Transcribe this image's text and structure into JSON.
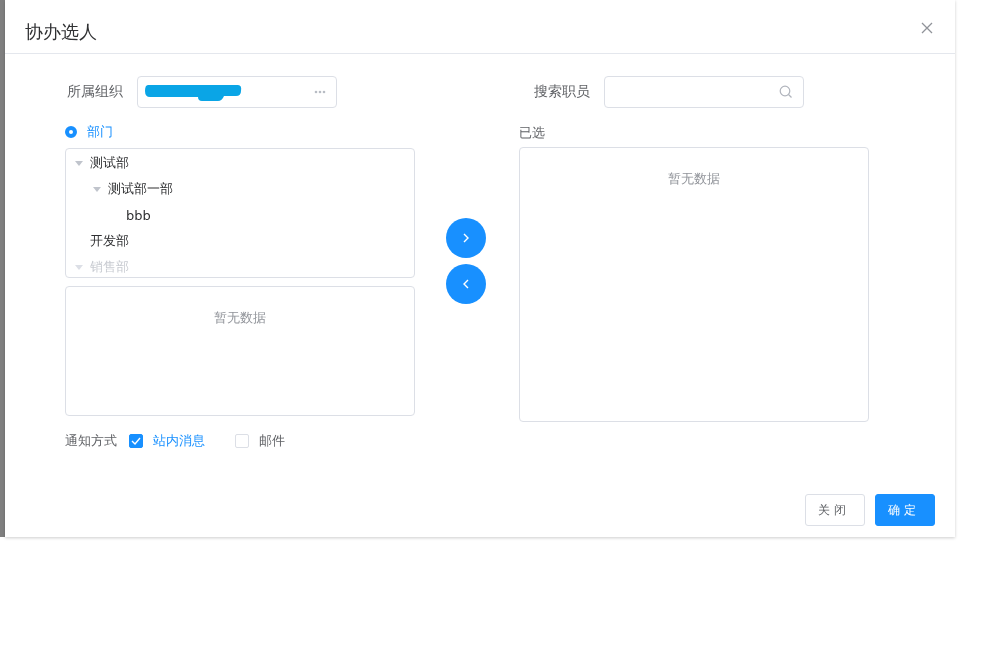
{
  "dialog": {
    "title": "协办选人"
  },
  "organization": {
    "label": "所属组织",
    "redacted": true
  },
  "search": {
    "label": "搜索职员"
  },
  "scope": {
    "label": "部门",
    "selected": true
  },
  "tree": [
    {
      "label": "测试部",
      "expanded": true,
      "disabled": false,
      "children": [
        {
          "label": "测试部一部",
          "expanded": true,
          "disabled": false,
          "children": [
            {
              "label": "bbb",
              "disabled": false
            }
          ]
        }
      ]
    },
    {
      "label": "开发部",
      "disabled": false
    },
    {
      "label": "销售部",
      "expanded": true,
      "disabled": true
    }
  ],
  "staff_list": {
    "empty_text": "暂无数据"
  },
  "selected_panel": {
    "title": "已选",
    "empty_text": "暂无数据"
  },
  "notify": {
    "label": "通知方式",
    "options": [
      {
        "label": "站内消息",
        "checked": true
      },
      {
        "label": "邮件",
        "checked": false
      }
    ]
  },
  "buttons": [
    {
      "label": "关闭",
      "kind": "default"
    },
    {
      "label": "确定",
      "kind": "primary"
    }
  ]
}
